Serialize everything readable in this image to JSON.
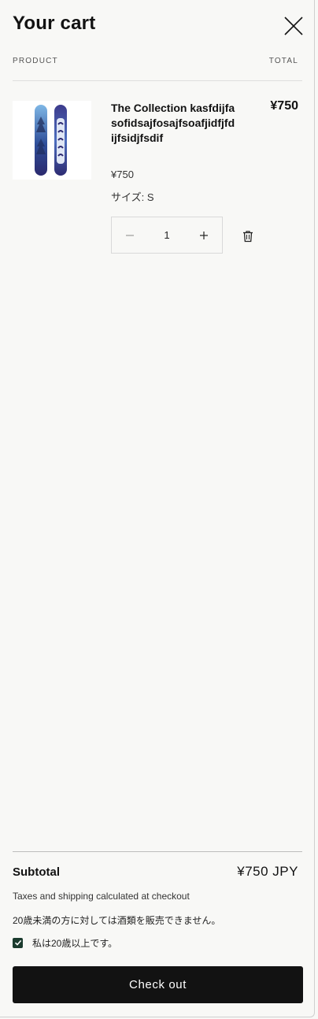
{
  "header": {
    "title": "Your cart",
    "close_icon": "close-icon"
  },
  "columns": {
    "product": "PRODUCT",
    "total": "TOTAL"
  },
  "item": {
    "name": "The Collection kasfdijfasofidsajfosajfsoafjidfjfdijfsidjfsdif",
    "line_total": "¥750",
    "unit_price": "¥750",
    "option_label": "サイズ:",
    "option_value": "S",
    "quantity": "1",
    "thumbnail_icon": "snowboard-image",
    "minus_icon": "minus-icon",
    "plus_icon": "plus-icon",
    "remove_icon": "trash-icon"
  },
  "footer": {
    "subtotal_label": "Subtotal",
    "subtotal_value": "¥750 JPY",
    "tax_note": "Taxes and shipping calculated at checkout",
    "age_notice": "20歳未満の方に対しては酒類を販売できません。",
    "age_confirm_label": "私は20歳以上です。",
    "age_confirm_checked": true,
    "checkout_label": "Check out"
  },
  "colors": {
    "background": "#f8f8f6",
    "button": "#121212",
    "checkbox": "#1b3b2e"
  }
}
